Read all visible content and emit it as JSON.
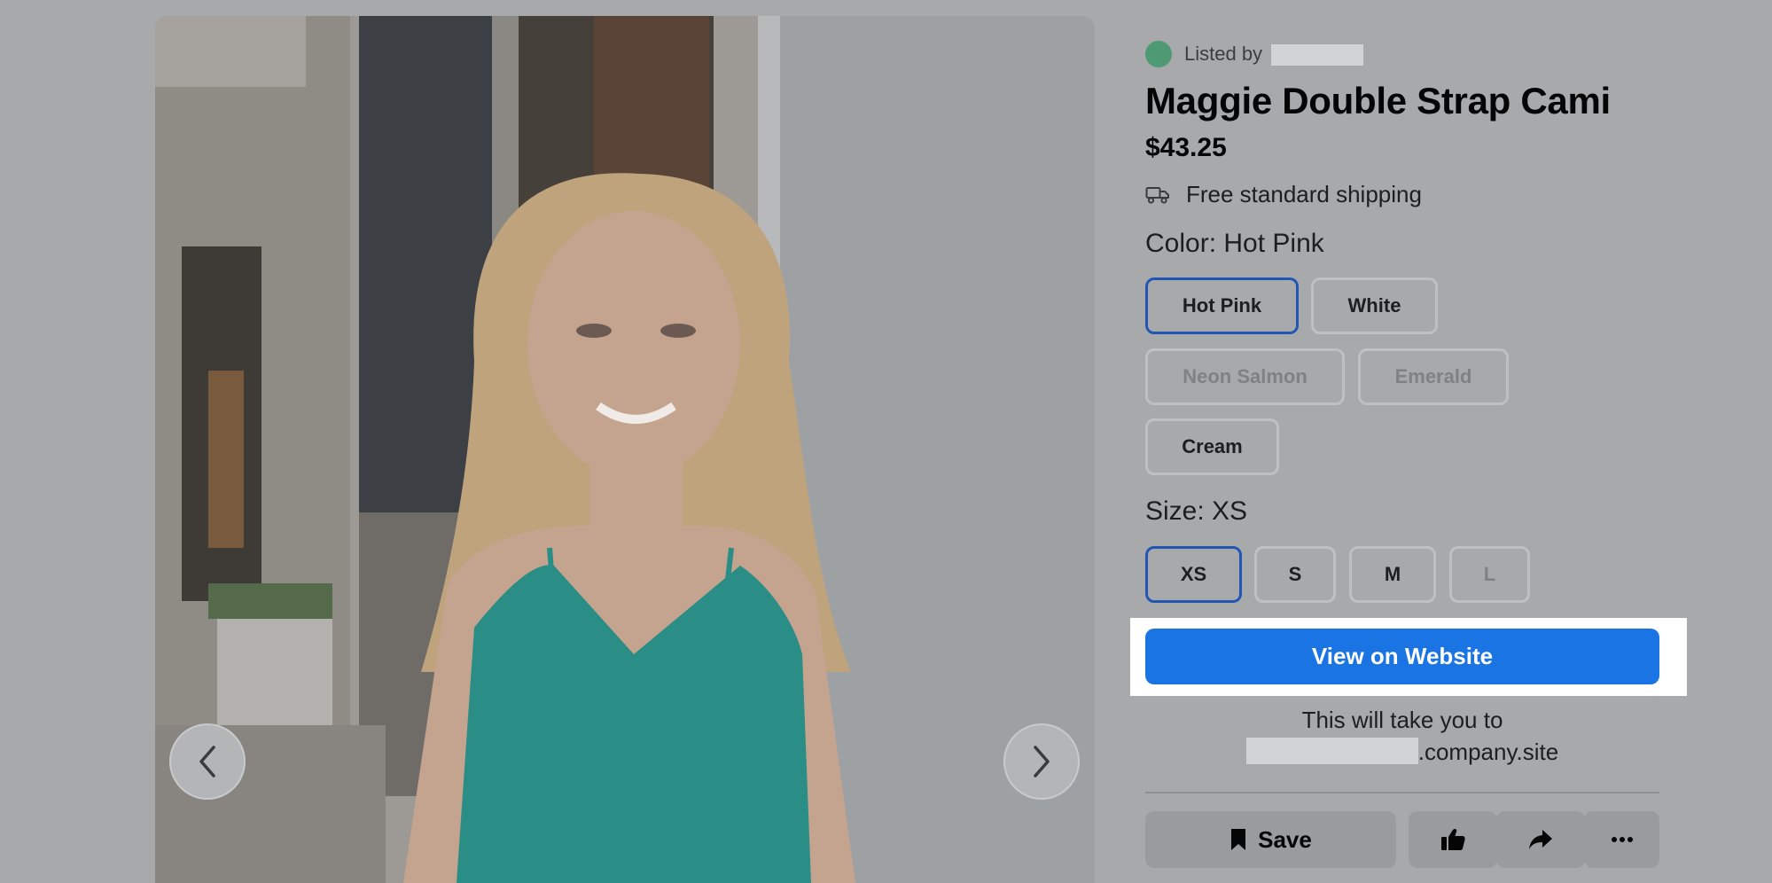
{
  "product": {
    "listed_by": "Listed by",
    "title": "Maggie Double Strap Cami",
    "price": "$43.25",
    "shipping": "Free standard shipping",
    "color_label": "Color:",
    "color_value": "Hot Pink",
    "colors": [
      "Hot Pink",
      "White",
      "Neon Salmon",
      "Emerald",
      "Cream"
    ],
    "selected_color": "Hot Pink",
    "disabled_colors": [
      "Neon Salmon",
      "Emerald"
    ],
    "size_label": "Size:",
    "size_value": "XS",
    "sizes": [
      "XS",
      "S",
      "M",
      "L"
    ],
    "selected_size": "XS",
    "disabled_sizes": [
      "L"
    ]
  },
  "cta": {
    "label": "View on Website",
    "note_line1": "This will take you to",
    "note_domain_suffix": ".company.site"
  },
  "actions": {
    "save_label": "Save"
  },
  "icons": {
    "carousel_prev": "chevron-left-icon",
    "carousel_next": "chevron-right-icon",
    "shipping": "truck-icon",
    "save": "bookmark-icon",
    "like": "thumbs-up-icon",
    "share": "share-icon",
    "more": "more-icon"
  },
  "colors": {
    "overlay_bg": "#a8a9ab",
    "accent": "#1b74e4",
    "selected_border": "#2256b4"
  }
}
